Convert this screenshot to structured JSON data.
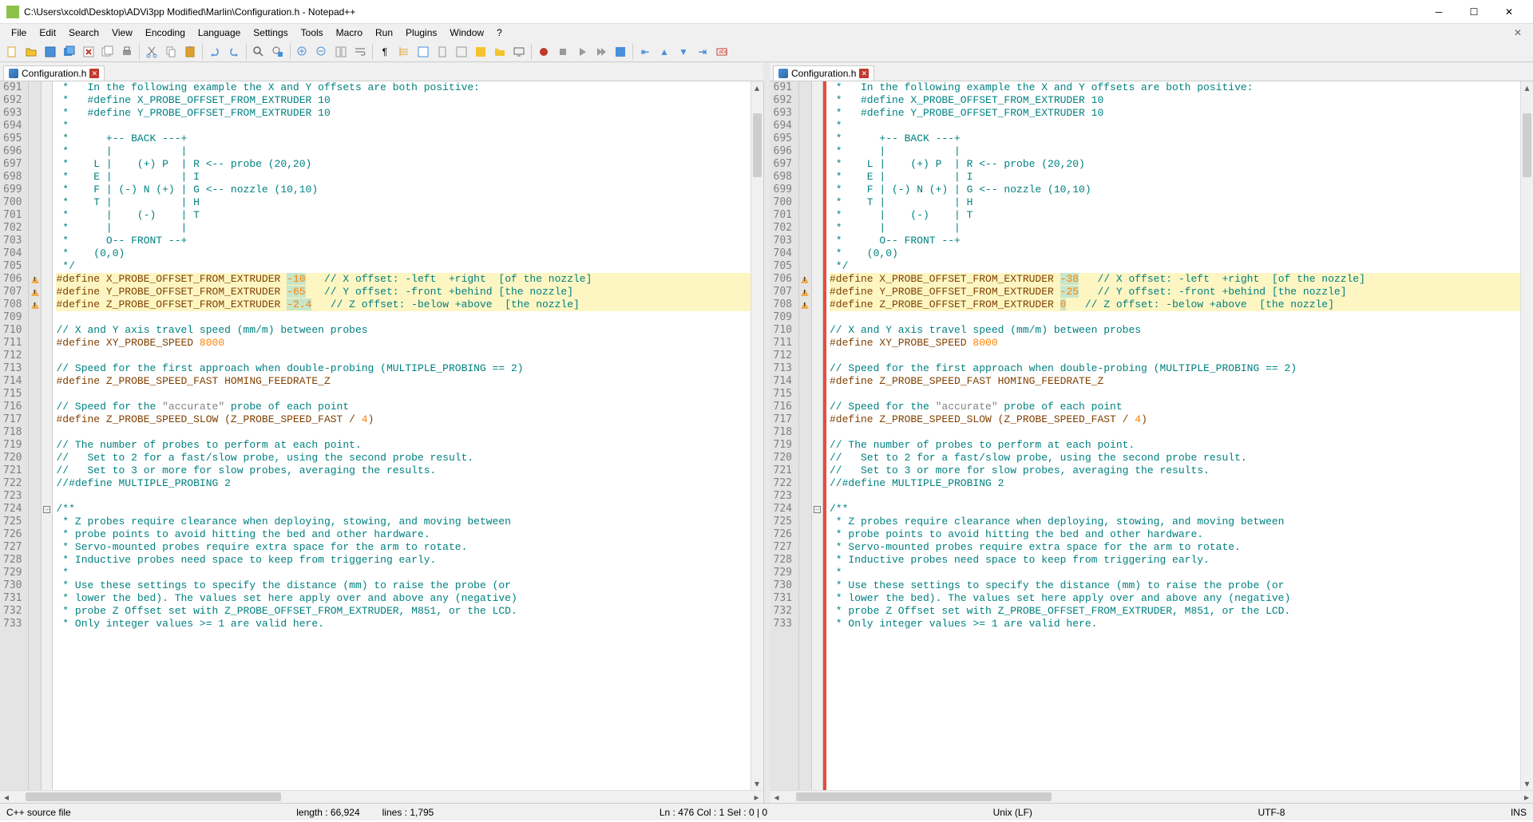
{
  "window": {
    "title": "C:\\Users\\xcold\\Desktop\\ADVi3pp Modified\\Marlin\\Configuration.h - Notepad++"
  },
  "menu": [
    "File",
    "Edit",
    "Search",
    "View",
    "Encoding",
    "Language",
    "Settings",
    "Tools",
    "Macro",
    "Run",
    "Plugins",
    "Window",
    "?"
  ],
  "tabs": {
    "left": "Configuration.h",
    "right": "Configuration.h"
  },
  "startLine": 691,
  "hlLines": [
    706,
    707,
    708
  ],
  "markLines": [
    706,
    707,
    708
  ],
  "foldLines": [
    724
  ],
  "leftValues": {
    "x": "-10",
    "y": "-65",
    "z": "-2.4"
  },
  "rightValues": {
    "x": "-38",
    "y": "-25",
    "z": "0"
  },
  "commonTop": [
    " *   In the following example the X and Y offsets are both positive:",
    " *   #define X_PROBE_OFFSET_FROM_EXTRUDER 10",
    " *   #define Y_PROBE_OFFSET_FROM_EXTRUDER 10",
    " *",
    " *      +-- BACK ---+",
    " *      |           |",
    " *    L |    (+) P  | R <-- probe (20,20)",
    " *    E |           | I",
    " *    F | (-) N (+) | G <-- nozzle (10,10)",
    " *    T |           | H",
    " *      |    (-)    | T",
    " *      |           |",
    " *      O-- FRONT --+",
    " *    (0,0)",
    " */"
  ],
  "commonAfter": [
    "",
    "// X and Y axis travel speed (mm/m) between probes",
    "#define XY_PROBE_SPEED 8000",
    "",
    "// Speed for the first approach when double-probing (MULTIPLE_PROBING == 2)",
    "#define Z_PROBE_SPEED_FAST HOMING_FEEDRATE_Z",
    "",
    "// Speed for the \"accurate\" probe of each point",
    "#define Z_PROBE_SPEED_SLOW (Z_PROBE_SPEED_FAST / 4)",
    "",
    "// The number of probes to perform at each point.",
    "//   Set to 2 for a fast/slow probe, using the second probe result.",
    "//   Set to 3 or more for slow probes, averaging the results.",
    "//#define MULTIPLE_PROBING 2",
    "",
    "/**",
    " * Z probes require clearance when deploying, stowing, and moving between",
    " * probe points to avoid hitting the bed and other hardware.",
    " * Servo-mounted probes require extra space for the arm to rotate.",
    " * Inductive probes need space to keep from triggering early.",
    " *",
    " * Use these settings to specify the distance (mm) to raise the probe (or",
    " * lower the bed). The values set here apply over and above any (negative)",
    " * probe Z Offset set with Z_PROBE_OFFSET_FROM_EXTRUDER, M851, or the LCD.",
    " * Only integer values >= 1 are valid here."
  ],
  "defineComments": {
    "x": "// X offset: -left  +right  [of the nozzle]",
    "y": "// Y offset: -front +behind [the nozzle]",
    "z": "// Z offset: -below +above  [the nozzle]"
  },
  "status": {
    "lang": "C++ source file",
    "length": "length : 66,924",
    "lines": "lines : 1,795",
    "pos": "Ln : 476   Col : 1   Sel : 0 | 0",
    "eol": "Unix (LF)",
    "enc": "UTF-8",
    "mode": "INS"
  }
}
